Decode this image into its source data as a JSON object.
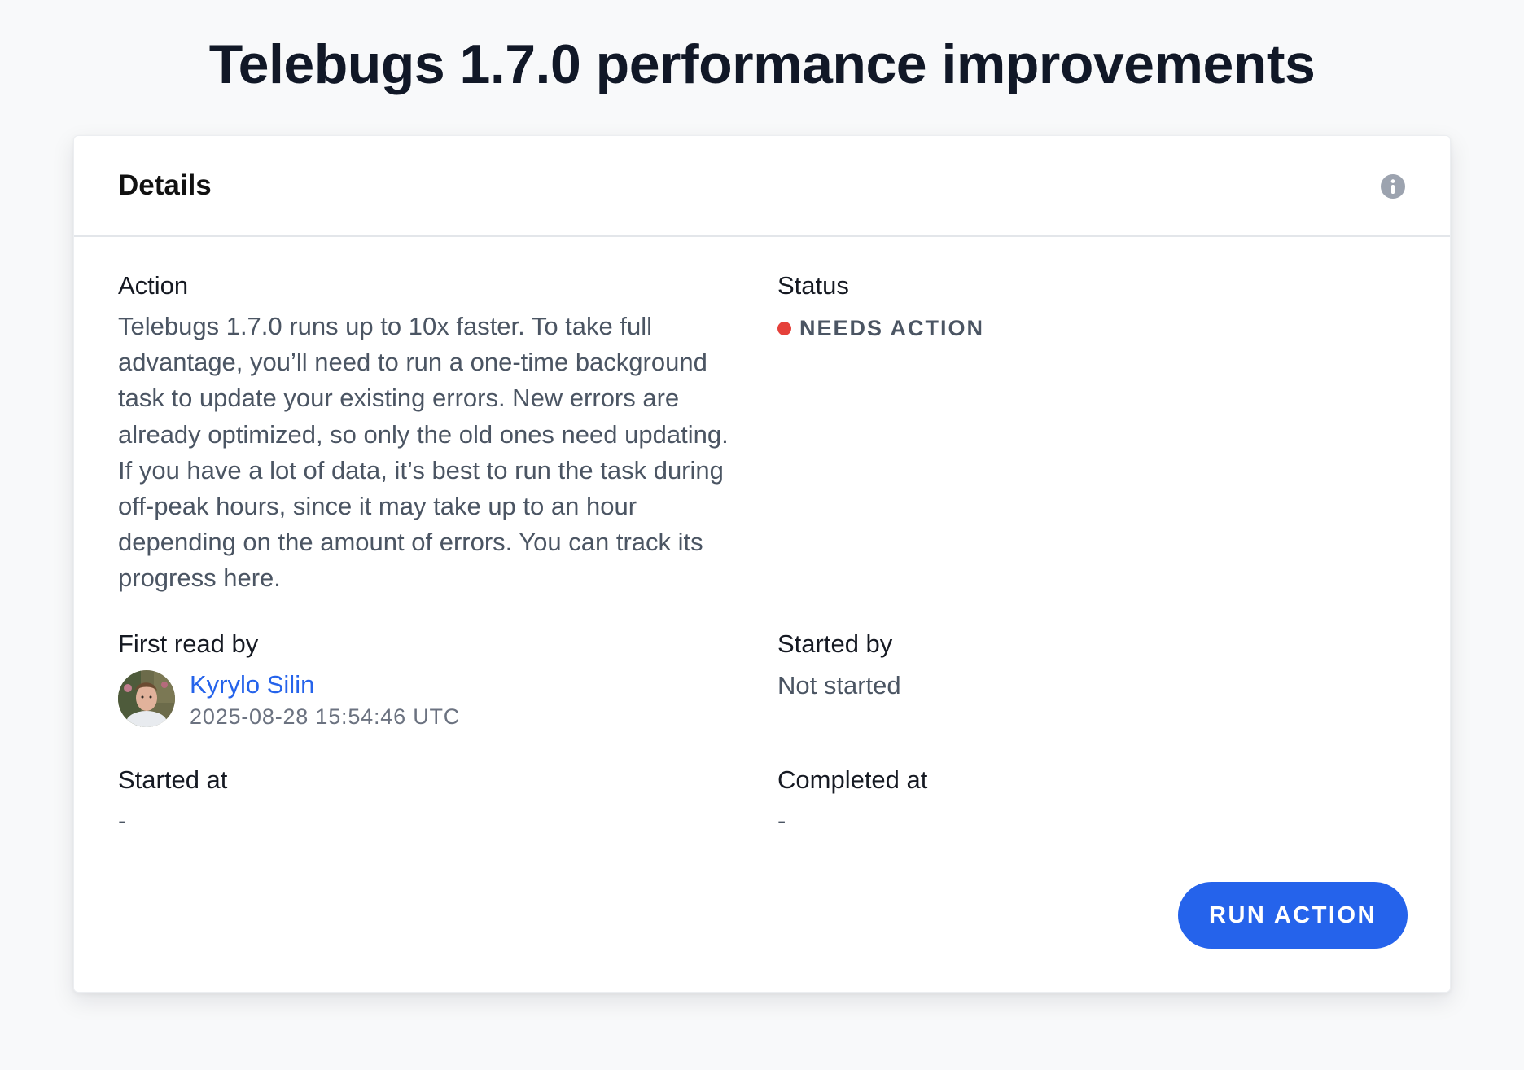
{
  "page": {
    "title": "Telebugs 1.7.0 performance improvements"
  },
  "card": {
    "title": "Details",
    "info_icon": "info-circle-icon"
  },
  "action": {
    "label": "Action",
    "description": "Telebugs 1.7.0 runs up to 10x faster. To take full advantage, you’ll need to run a one-time background task to update your existing errors. New errors are already optimized, so only the old ones need updating. If you have a lot of data, it’s best to run the task during off-peak hours, since it may take up to an hour depending on the amount of errors. You can track its progress here."
  },
  "status": {
    "label": "Status",
    "value": "NEEDS ACTION",
    "dot_color": "#e5403a"
  },
  "first_read_by": {
    "label": "First read by",
    "user_name": "Kyrylo Silin",
    "timestamp": "2025-08-28 15:54:46 UTC"
  },
  "started_by": {
    "label": "Started by",
    "value": "Not started"
  },
  "started_at": {
    "label": "Started at",
    "value": "-"
  },
  "completed_at": {
    "label": "Completed at",
    "value": "-"
  },
  "run_action": {
    "label": "RUN ACTION"
  },
  "colors": {
    "accent": "#2563eb",
    "background": "#f8f9fa",
    "card": "#ffffff",
    "status_red": "#e5403a"
  }
}
